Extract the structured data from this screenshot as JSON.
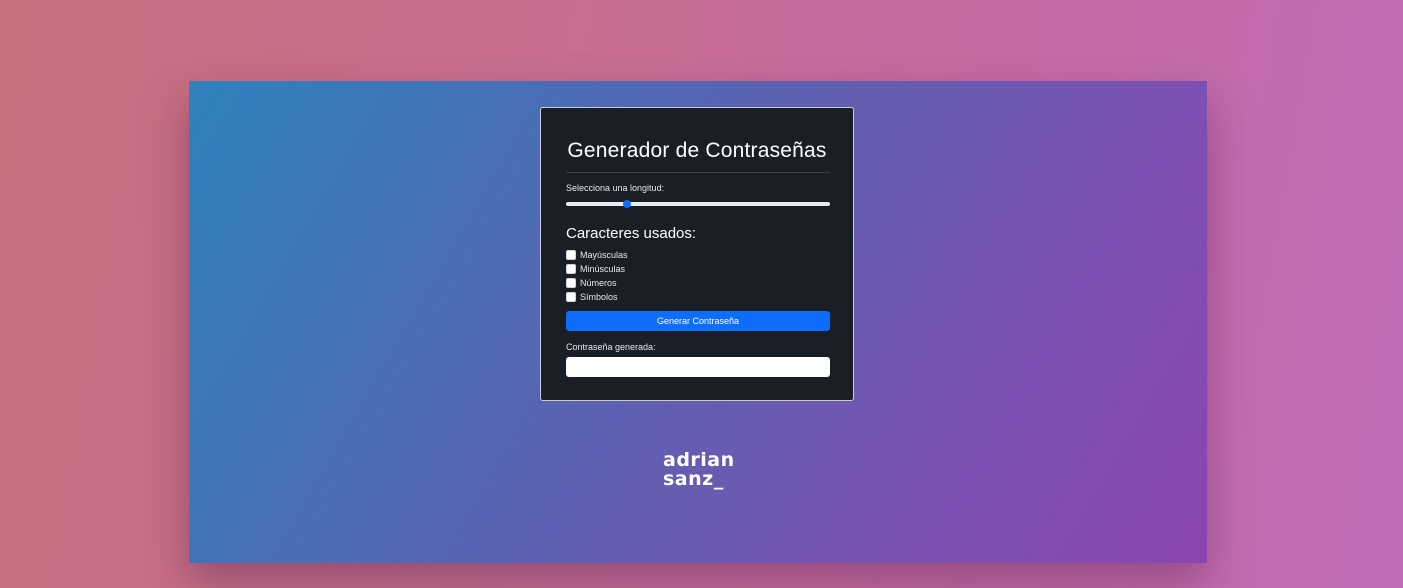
{
  "generator": {
    "title": "Generador de Contraseñas",
    "length_label": "Selecciona una longitud:",
    "length_fraction": 0.23,
    "chars_title": "Caracteres usados:",
    "options": [
      {
        "label": "Mayúsculas",
        "checked": false
      },
      {
        "label": "Minúsculas",
        "checked": false
      },
      {
        "label": "Números",
        "checked": false
      },
      {
        "label": "Símbolos",
        "checked": false
      }
    ],
    "generate_button": "Generar Contraseña",
    "output_label": "Contraseña generada:",
    "output_value": ""
  },
  "brand": {
    "line1": "adrian",
    "line2": "sanz_"
  },
  "colors": {
    "accent": "#0d6efd",
    "card_bg": "#1a1f27"
  }
}
